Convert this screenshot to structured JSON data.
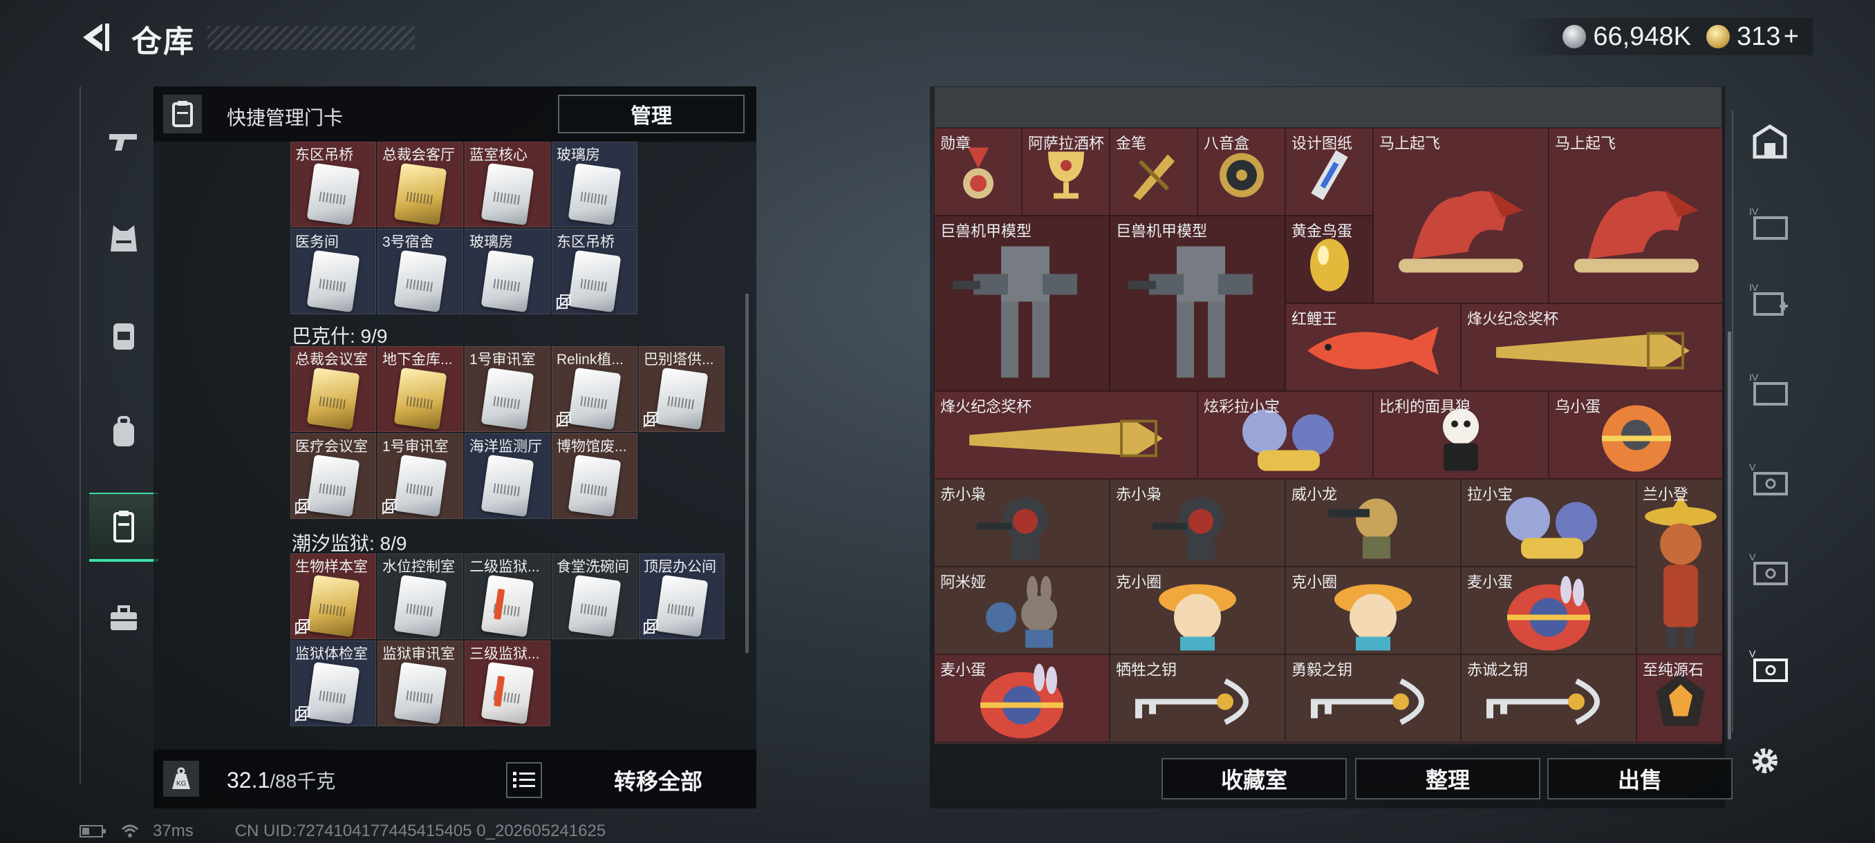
{
  "header": {
    "title": "仓库",
    "currency_silver": "66,948K",
    "currency_gold": "313",
    "currency_gold_plus": "+"
  },
  "left_panel": {
    "quick_label": "快捷管理门卡",
    "manage_label": "管理",
    "sections": [
      {
        "title": "",
        "rows": [
          [
            {
              "name": "东区吊桥",
              "bg": "red",
              "card": "white"
            },
            {
              "name": "总裁会客厅",
              "bg": "red",
              "card": "gold"
            },
            {
              "name": "蓝室核心",
              "bg": "red",
              "card": "white"
            },
            {
              "name": "玻璃房",
              "bg": "blue",
              "card": "white"
            }
          ],
          [
            {
              "name": "医务间",
              "bg": "blue",
              "card": "white"
            },
            {
              "name": "3号宿舍",
              "bg": "blue",
              "card": "white"
            },
            {
              "name": "玻璃房",
              "bg": "blue",
              "card": "white"
            },
            {
              "name": "东区吊桥",
              "bg": "blue",
              "card": "white",
              "locked": true
            }
          ]
        ]
      },
      {
        "title": "巴克什: 9/9",
        "rows": [
          [
            {
              "name": "总裁会议室",
              "bg": "red",
              "card": "gold"
            },
            {
              "name": "地下金库...",
              "bg": "red",
              "card": "gold"
            },
            {
              "name": "1号审讯室",
              "bg": "brown",
              "card": "white"
            },
            {
              "name": "Relink植...",
              "bg": "brown",
              "card": "white",
              "locked": true
            },
            {
              "name": "巴别塔供...",
              "bg": "brown",
              "card": "white",
              "locked": true
            }
          ],
          [
            {
              "name": "医疗会议室",
              "bg": "brown",
              "card": "white",
              "locked": true
            },
            {
              "name": "1号审讯室",
              "bg": "brown",
              "card": "white",
              "locked": true
            },
            {
              "name": "海洋监测厅",
              "bg": "blue",
              "card": "white"
            },
            {
              "name": "博物馆废...",
              "bg": "brown",
              "card": "white"
            }
          ]
        ]
      },
      {
        "title": "潮汐监狱: 8/9",
        "rows": [
          [
            {
              "name": "生物样本室",
              "bg": "red",
              "card": "gold",
              "locked": true
            },
            {
              "name": "水位控制室",
              "bg": "dark",
              "card": "white"
            },
            {
              "name": "二级监狱...",
              "bg": "dark",
              "card": "red"
            },
            {
              "name": "食堂洗碗间",
              "bg": "dark",
              "card": "white"
            },
            {
              "name": "顶层办公间",
              "bg": "blue",
              "card": "white",
              "locked": true
            }
          ],
          [
            {
              "name": "监狱体检室",
              "bg": "blue",
              "card": "white",
              "locked": true
            },
            {
              "name": "监狱审讯室",
              "bg": "brown",
              "card": "white"
            },
            {
              "name": "三级监狱...",
              "bg": "red",
              "card": "red"
            }
          ]
        ]
      }
    ],
    "weight_value": "32.1",
    "weight_max": "/88千克",
    "transfer_label": "转移全部"
  },
  "right_panel": {
    "items": [
      {
        "name": "勋章",
        "icon": "medal-icon"
      },
      {
        "name": "阿萨拉酒杯",
        "icon": "goblet-icon"
      },
      {
        "name": "金笔",
        "icon": "pen-icon"
      },
      {
        "name": "八音盒",
        "icon": "music-box-icon"
      },
      {
        "name": "设计图纸",
        "icon": "blueprint-icon"
      },
      {
        "name": "马上起飞",
        "icon": "horse-statue-icon"
      },
      {
        "name": "马上起飞",
        "icon": "horse-statue-icon"
      },
      {
        "name": "巨兽机甲模型",
        "icon": "mech-icon"
      },
      {
        "name": "巨兽机甲模型",
        "icon": "mech-icon"
      },
      {
        "name": "黄金鸟蛋",
        "icon": "golden-egg-icon"
      },
      {
        "name": "红鲤王",
        "icon": "carp-icon"
      },
      {
        "name": "烽火纪念奖杯",
        "icon": "trophy-icon"
      },
      {
        "name": "烽火纪念奖杯",
        "icon": "trophy-icon"
      },
      {
        "name": "炫彩拉小宝",
        "icon": "figure-icon"
      },
      {
        "name": "比利的面具狼",
        "icon": "mask-figure-icon"
      },
      {
        "name": "乌小蛋",
        "icon": "egg-figure-icon"
      },
      {
        "name": "赤小枭",
        "icon": "owl-figure-icon"
      },
      {
        "name": "赤小枭",
        "icon": "owl-figure-icon"
      },
      {
        "name": "威小龙",
        "icon": "dragon-figure-icon"
      },
      {
        "name": "拉小宝",
        "icon": "figure-icon"
      },
      {
        "name": "兰小登",
        "icon": "sombrero-figure-icon"
      },
      {
        "name": "阿米娅",
        "icon": "bunny-figure-icon"
      },
      {
        "name": "克小圈",
        "icon": "hat-figure-icon"
      },
      {
        "name": "克小圈",
        "icon": "hat-figure-icon"
      },
      {
        "name": "麦小蛋",
        "icon": "bunny-egg-icon"
      },
      {
        "name": "麦小蛋",
        "icon": "bunny-egg-icon"
      },
      {
        "name": "牺牲之钥",
        "icon": "key-icon"
      },
      {
        "name": "勇毅之钥",
        "icon": "key-icon"
      },
      {
        "name": "赤诚之钥",
        "icon": "key-icon"
      },
      {
        "name": "至纯源石",
        "icon": "crystal-icon"
      }
    ],
    "buttons": {
      "collection": "收藏室",
      "sort": "整理",
      "sell": "出售"
    }
  },
  "status": {
    "ping": "37ms",
    "uid": "CN UID:7274104177445415405 0_202605241625"
  },
  "colors": {
    "accent": "#3fe0a9",
    "panel": "#14181c",
    "slot_red": "#5a2b2f"
  }
}
